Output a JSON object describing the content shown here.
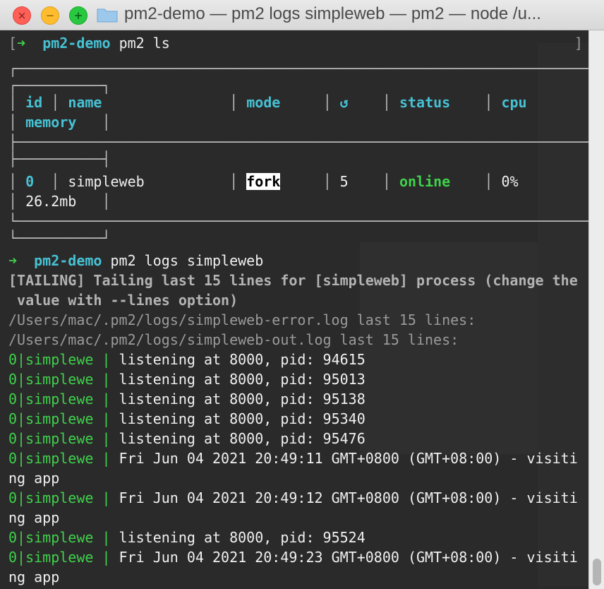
{
  "window": {
    "title": "pm2-demo — pm2 logs simpleweb — pm2 — node /u...",
    "close_glyph": "×",
    "minimize_glyph": "−",
    "zoom_glyph": "+"
  },
  "prompt1": {
    "open_bracket": "[",
    "arrow": "➜",
    "dir": "pm2-demo",
    "command": "pm2 ls",
    "close_bracket": "]"
  },
  "table": {
    "border_top": "┌─────────────────────────────────────────────────────────────────────────────────┐",
    "border_top2": "┌──────────┐",
    "header": {
      "col_id": "id",
      "col_name": "name",
      "col_mode": "mode",
      "col_restart": "↺",
      "col_status": "status",
      "col_cpu": "cpu",
      "col_memory": "memory"
    },
    "sep1": "├─────────────────────────────────────────────────────────────────────────────────┤",
    "sep2": "├──────────┤",
    "row": {
      "id": "0",
      "name": "simpleweb",
      "mode": "fork",
      "restarts": "5",
      "status": "online",
      "cpu": "0%",
      "memory": "26.2mb"
    },
    "border_bottom": "└─────────────────────────────────────────────────────────────────────────────────┘",
    "border_bottom2": "└──────────┘"
  },
  "prompt2": {
    "arrow": "➜",
    "dir": "pm2-demo",
    "command": "pm2 logs simpleweb"
  },
  "tailing": {
    "line1": "[TAILING] Tailing last 15 lines for [simpleweb] process (change the",
    "line2": " value with --lines option)"
  },
  "log_files": [
    "/Users/mac/.pm2/logs/simpleweb-error.log last 15 lines:",
    "/Users/mac/.pm2/logs/simpleweb-out.log last 15 lines:"
  ],
  "log_prefix": "0|simplewe",
  "log_sep": " | ",
  "log_lines": [
    {
      "msg": "listening at 8000, pid: 94615"
    },
    {
      "msg": "listening at 8000, pid: 95013"
    },
    {
      "msg": "listening at 8000, pid: 95138"
    },
    {
      "msg": "listening at 8000, pid: 95340"
    },
    {
      "msg": "listening at 8000, pid: 95476"
    },
    {
      "msg": "Fri Jun 04 2021 20:49:11 GMT+0800 (GMT+08:00) - visiti",
      "cont": "ng app"
    },
    {
      "msg": "Fri Jun 04 2021 20:49:12 GMT+0800 (GMT+08:00) - visiti",
      "cont": "ng app"
    },
    {
      "msg": "listening at 8000, pid: 95524"
    },
    {
      "msg": "Fri Jun 04 2021 20:49:23 GMT+0800 (GMT+08:00) - visiti",
      "cont": "ng app"
    }
  ],
  "colors": {
    "cyan": "#46c2d4",
    "green": "#3fd14b",
    "terminal_bg": "#2a2a2a"
  },
  "icons": {
    "folder": "folder-icon"
  }
}
